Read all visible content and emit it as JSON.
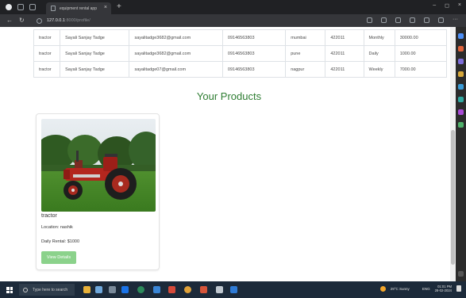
{
  "browser": {
    "tab_title": "equipment rental app",
    "url_host": "127.0.0.1",
    "url_path": ":8000/profile/"
  },
  "rentals_table": {
    "rows": [
      [
        "tractor",
        "Sayali Sanjay Tadge",
        "sayalitadge3682@gmail.com",
        "09146563803",
        "mumbai",
        "422011",
        "Monthly",
        "30000.00"
      ],
      [
        "tractor",
        "Sayali Sanjay Tadge",
        "sayalitadge3682@gmail.com",
        "09146563803",
        "pune",
        "422011",
        "Daily",
        "1000.00"
      ],
      [
        "tractor",
        "Sayali Sanjay Tadge",
        "sayalitadge07@gmail.com",
        "09146563803",
        "nagpur",
        "422011",
        "Weekly",
        "7000.00"
      ]
    ]
  },
  "products": {
    "title": "Your Products",
    "items": [
      {
        "name": "tractor",
        "location": "Location: nashik",
        "rental": "Daily Rental: $1000",
        "button": "View Details"
      }
    ]
  },
  "taskbar": {
    "search_placeholder": "Type here to search",
    "weather": "29°C Sunny",
    "language": "ENG",
    "time": "01:01 PM",
    "date": "28-02-2024"
  },
  "colors": {
    "section_title": "#2e7d32",
    "button": "#8bd28b",
    "browser_chrome": "#202124"
  },
  "icons": [
    "back-arrow",
    "reload",
    "info",
    "star",
    "extensions",
    "favorites",
    "collections",
    "settings-more",
    "windows-start",
    "search"
  ]
}
